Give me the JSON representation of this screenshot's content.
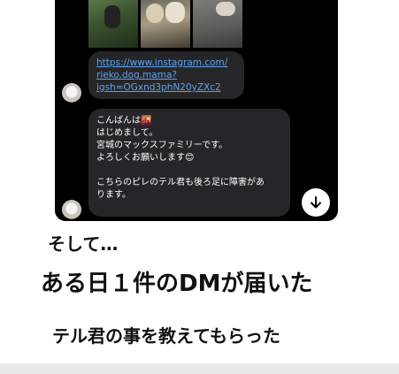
{
  "chat": {
    "link_lines": [
      "https://www.instagram.com/",
      "rieko.dog.mama?",
      "igsh=OGxnd3phN20yZXc2"
    ],
    "message_lines": [
      "こんばんは🌇",
      "はじめまして。",
      "宮城のマックスファミリーです。",
      "よろしくお願いします😊",
      "",
      "こちらのピレのテル君も後ろ足に障害があ",
      "ります。"
    ]
  },
  "captions": {
    "line1": "そして…",
    "line2": "ある日１件のDMが届いた",
    "line3": "テル君の事を教えてもらった"
  },
  "icons": {
    "scroll": "arrow-down-icon",
    "avatar": "user-avatar"
  }
}
